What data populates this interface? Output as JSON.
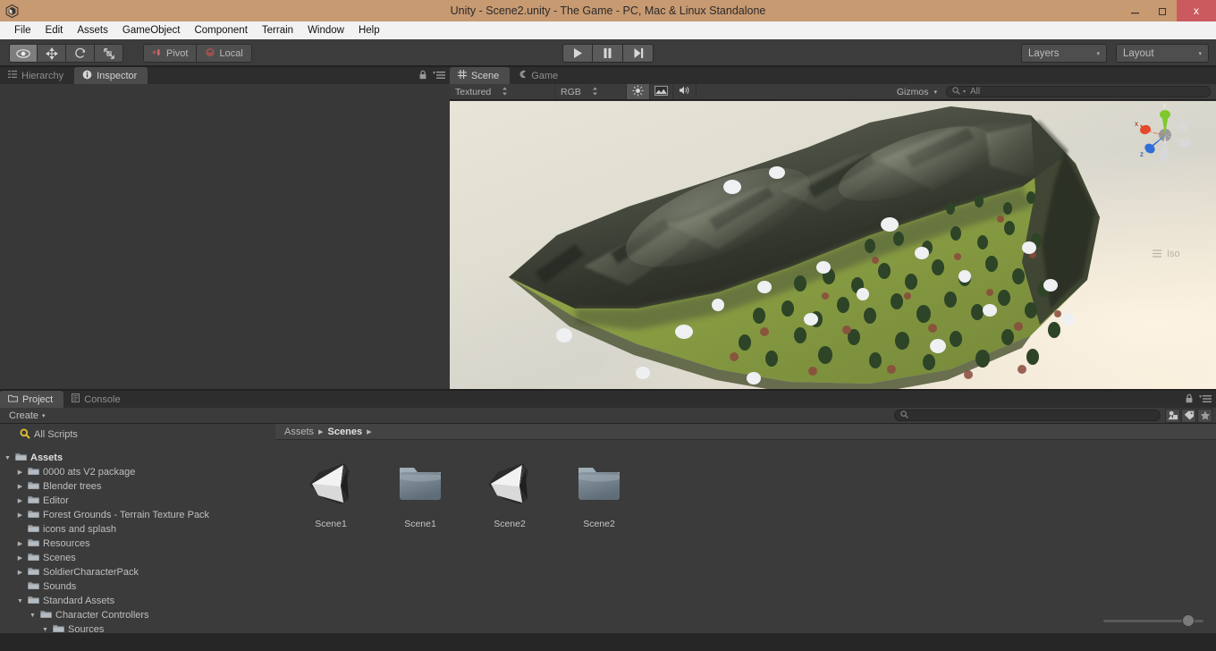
{
  "window": {
    "title": "Unity - Scene2.unity - The Game - PC, Mac & Linux Standalone",
    "logo_icon": "unity-logo-icon",
    "minimize_label": "–",
    "restore_label": "❐",
    "close_label": "x",
    "titlebar_color": "#c79a72",
    "close_color": "#cb5a5e"
  },
  "menubar": {
    "items": [
      {
        "label": "File"
      },
      {
        "label": "Edit"
      },
      {
        "label": "Assets"
      },
      {
        "label": "GameObject"
      },
      {
        "label": "Component"
      },
      {
        "label": "Terrain"
      },
      {
        "label": "Window"
      },
      {
        "label": "Help"
      }
    ]
  },
  "toolbar": {
    "transform_tools": [
      {
        "name": "hand-tool",
        "icon": "eye-icon",
        "selected": true
      },
      {
        "name": "move-tool",
        "icon": "move-arrows-icon",
        "selected": false
      },
      {
        "name": "rotate-tool",
        "icon": "rotate-icon",
        "selected": false
      },
      {
        "name": "scale-tool",
        "icon": "scale-icon",
        "selected": false
      }
    ],
    "pivot_label": "Pivot",
    "pivot_icon": "pivot-icon",
    "local_label": "Local",
    "local_icon": "local-rotation-icon",
    "play_label": "play-icon",
    "pause_label": "pause-icon",
    "step_label": "step-icon",
    "layers_label": "Layers",
    "layout_label": "Layout",
    "dropdown_arrow": "▾"
  },
  "left_panel": {
    "tabs": [
      {
        "label": "Hierarchy",
        "icon": "hierarchy-icon",
        "active": false
      },
      {
        "label": "Inspector",
        "icon": "info-icon",
        "active": true
      }
    ],
    "lock_icon": "lock-icon",
    "menu_icon": "panel-menu-icon"
  },
  "scene_panel": {
    "tabs": [
      {
        "label": "Scene",
        "icon": "grid-icon",
        "active": true
      },
      {
        "label": "Game",
        "icon": "gamepad-icon",
        "active": false
      }
    ],
    "draw_mode": "Textured",
    "color_mode": "RGB",
    "lighting_icon": "sun-icon",
    "fx_icon": "image-effects-icon",
    "audio_icon": "audio-icon",
    "gizmos_label": "Gizmos",
    "search_placeholder": "All",
    "search_icon": "search-icon",
    "gizmo_axes": {
      "x": "x",
      "y": "y",
      "z": "z"
    },
    "projection_label": "Iso",
    "axis_colors": {
      "x": "#e44a2a",
      "y": "#7ec92a",
      "z": "#2f6fd8"
    },
    "background_top": "#e6e3d6",
    "background_bottom": "#f7edda"
  },
  "project_panel": {
    "tabs": [
      {
        "label": "Project",
        "icon": "folder-icon",
        "active": true
      },
      {
        "label": "Console",
        "icon": "console-icon",
        "active": false
      }
    ],
    "create_label": "Create",
    "create_arrow": "▾",
    "search_placeholder": "",
    "search_icon": "search-icon",
    "filter_icons": [
      {
        "name": "filter-by-type-icon",
        "glyph": "type"
      },
      {
        "name": "filter-by-label-icon",
        "glyph": "tag"
      },
      {
        "name": "favorites-star-icon",
        "glyph": "star"
      }
    ],
    "lock_icon": "lock-icon",
    "menu_icon": "panel-menu-icon",
    "tree": [
      {
        "label": "All Scripts",
        "depth": 0,
        "twist": "none",
        "icon": "search-yellow-icon",
        "bold": false
      },
      {
        "label": "",
        "depth": 0,
        "twist": "none",
        "icon": "spacer",
        "bold": false
      },
      {
        "label": "Assets",
        "depth": 0,
        "twist": "open",
        "icon": "folder-icon",
        "bold": true
      },
      {
        "label": "0000 ats V2 package",
        "depth": 1,
        "twist": "closed",
        "icon": "folder-icon",
        "bold": false
      },
      {
        "label": "Blender trees",
        "depth": 1,
        "twist": "closed",
        "icon": "folder-icon",
        "bold": false
      },
      {
        "label": "Editor",
        "depth": 1,
        "twist": "closed",
        "icon": "folder-icon",
        "bold": false
      },
      {
        "label": "Forest Grounds - Terrain Texture Pack",
        "depth": 1,
        "twist": "closed",
        "icon": "folder-icon",
        "bold": false
      },
      {
        "label": "icons and splash",
        "depth": 1,
        "twist": "none",
        "icon": "folder-icon",
        "bold": false
      },
      {
        "label": "Resources",
        "depth": 1,
        "twist": "closed",
        "icon": "folder-icon",
        "bold": false
      },
      {
        "label": "Scenes",
        "depth": 1,
        "twist": "closed",
        "icon": "folder-icon",
        "bold": false
      },
      {
        "label": "SoldierCharacterPack",
        "depth": 1,
        "twist": "closed",
        "icon": "folder-icon",
        "bold": false
      },
      {
        "label": "Sounds",
        "depth": 1,
        "twist": "none",
        "icon": "folder-icon",
        "bold": false
      },
      {
        "label": "Standard Assets",
        "depth": 1,
        "twist": "open",
        "icon": "folder-icon",
        "bold": false
      },
      {
        "label": "Character Controllers",
        "depth": 2,
        "twist": "open",
        "icon": "folder-icon",
        "bold": false
      },
      {
        "label": "Sources",
        "depth": 3,
        "twist": "open",
        "icon": "folder-icon",
        "bold": false
      }
    ],
    "breadcrumb": [
      {
        "label": "Assets",
        "current": false
      },
      {
        "label": "Scenes",
        "current": true
      }
    ],
    "breadcrumb_sep": "▸",
    "assets": [
      {
        "name": "Scene1",
        "type": "scene"
      },
      {
        "name": "Scene1",
        "type": "folder"
      },
      {
        "name": "Scene2",
        "type": "scene"
      },
      {
        "name": "Scene2",
        "type": "folder"
      }
    ],
    "zoom_slider_value": 78
  }
}
